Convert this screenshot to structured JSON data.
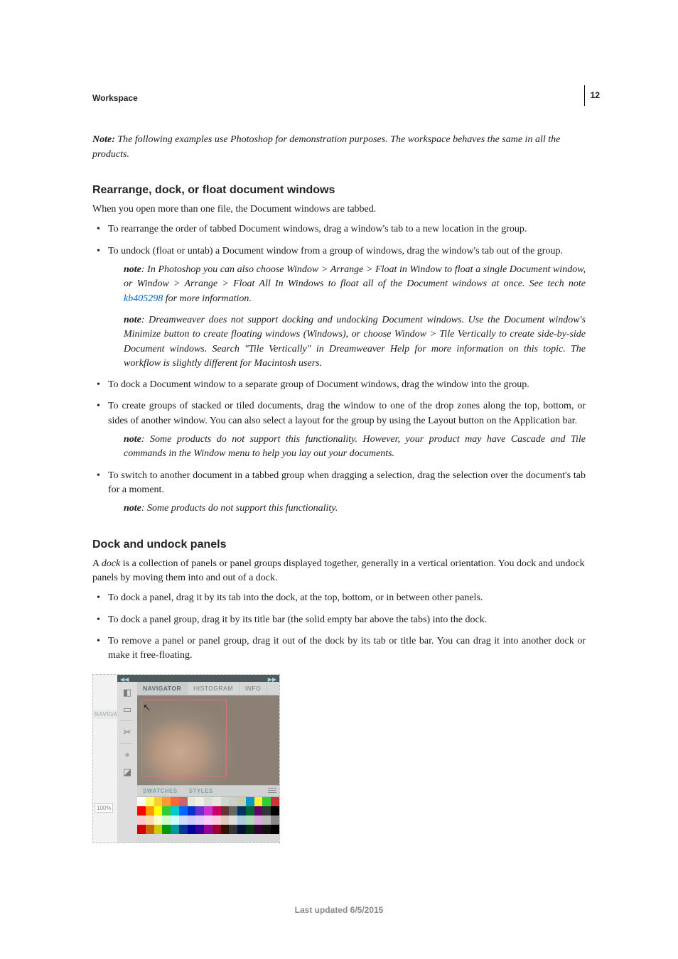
{
  "page_number": "12",
  "section": "Workspace",
  "intro_note_label": "Note:",
  "intro_note_text": " The following examples use Photoshop for demonstration purposes. The workspace behaves the same in all the products.",
  "h1": "Rearrange, dock, or float document windows",
  "h1_intro": "When you open more than one file, the Document windows are tabbed.",
  "b1": "To rearrange the order of tabbed Document windows, drag a window's tab to a new location in the group.",
  "b2": "To undock (float or untab) a Document window from a group of windows, drag the window's tab out of the group.",
  "b2_note_label": "note",
  "b2_note_a": ": In Photoshop you can also choose Window > Arrange > Float in Window to float a single Document window, or Window > Arrange > Float All In Windows to float all of the Document windows at once. See tech note ",
  "b2_note_link": "kb405298",
  "b2_note_b": " for more information.",
  "b2_note2_label": "note",
  "b2_note2": ": Dreamweaver does not support docking and undocking Document windows. Use the Document window's Minimize button to create floating windows (Windows), or choose Window > Tile Vertically to create side-by-side Document windows. Search \"Tile Vertically\" in Dreamweaver Help for more information on this topic. The workflow is slightly different for Macintosh users.",
  "b3": "To dock a Document window to a separate group of Document windows, drag the window into the group.",
  "b4": "To create groups of stacked or tiled documents, drag the window to one of the drop zones along the top, bottom, or sides of another window. You can also select a layout for the group by using the Layout button on the Application bar.",
  "b4_note_label": "note",
  "b4_note": ": Some products do not support this functionality. However, your product may have Cascade and Tile commands in the Window menu to help you lay out your documents.",
  "b5": "To switch to another document in a tabbed group when dragging a selection, drag the selection over the document's tab for a moment.",
  "b5_note_label": "note",
  "b5_note": ": Some products do not support this functionality.",
  "h2": "Dock and undock panels",
  "h2_intro_a": "A ",
  "h2_intro_em": "dock",
  "h2_intro_b": " is a collection of panels or panel groups displayed together, generally in a vertical orientation. You dock and undock panels by moving them into and out of a dock.",
  "c1": "To dock a panel, drag it by its tab into the dock, at the top, bottom, or in between other panels.",
  "c2": "To dock a panel group, drag it by its title bar (the solid empty bar above the tabs) into the dock.",
  "c3": "To remove a panel or panel group, drag it out of the dock by its tab or title bar. You can drag it into another dock or make it free-floating.",
  "figure": {
    "left_label": "NAVIGATI",
    "percent": "100%",
    "tabs": {
      "navigator": "NAVIGATOR",
      "histogram": "HISTOGRAM",
      "info": "INFO"
    },
    "tabs2": {
      "swatches": "SWATCHES",
      "styles": "STYLES"
    },
    "swatch_rows": [
      [
        "#ffffff",
        "#ffff66",
        "#ffcc33",
        "#ff9933",
        "#ff6633",
        "#cc6666",
        "#e8e8d8",
        "#f0f0e8",
        "#d8e0d8",
        "#e8e8e0",
        "#d0d8d0",
        "#c8d0c8",
        "#ccccaa",
        "#0099cc",
        "#ffee33",
        "#33cc33",
        "#cc3333"
      ],
      [
        "#ff0000",
        "#ff9900",
        "#ffff00",
        "#33cc33",
        "#00cccc",
        "#0066ff",
        "#0033cc",
        "#6633cc",
        "#cc33cc",
        "#cc0066",
        "#663333",
        "#666666",
        "#003366",
        "#006633",
        "#660066",
        "#333333",
        "#000000"
      ],
      [
        "#ffcccc",
        "#ffddaa",
        "#ffffcc",
        "#ccffcc",
        "#ccffff",
        "#ccddff",
        "#ccccff",
        "#e0ccff",
        "#ffccff",
        "#ffccdd",
        "#ddccbb",
        "#dddddd",
        "#aaccdd",
        "#aaddbb",
        "#ddaadd",
        "#bbbbbb",
        "#888888"
      ],
      [
        "#cc0000",
        "#cc6600",
        "#cccc00",
        "#009900",
        "#009999",
        "#003399",
        "#000099",
        "#330099",
        "#990099",
        "#990033",
        "#331100",
        "#333333",
        "#001133",
        "#003311",
        "#330033",
        "#111111",
        "#000000"
      ]
    ]
  },
  "footer": "Last updated 6/5/2015"
}
